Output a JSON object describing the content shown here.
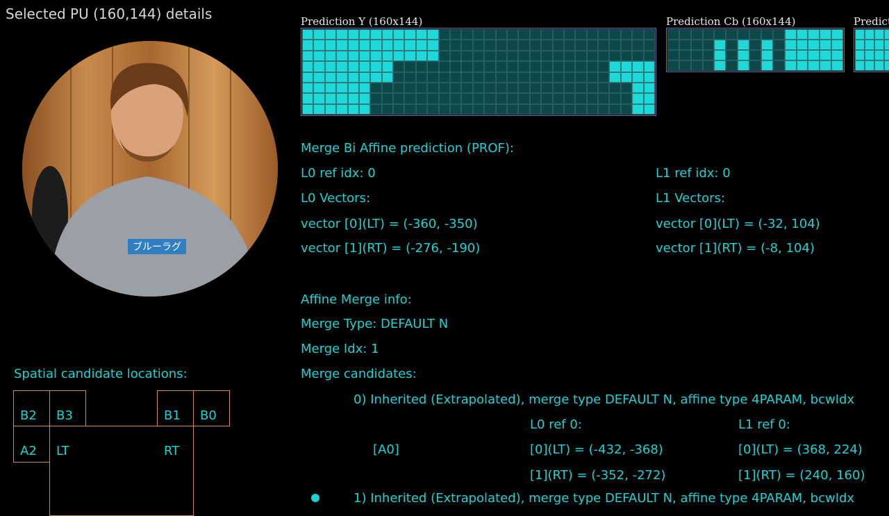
{
  "header": {
    "title": "Selected PU (160,144) details"
  },
  "avatar": {
    "shirt_text": "ブルーラグ"
  },
  "predictions": {
    "y": {
      "label": "Prediction Y (160x144)"
    },
    "cb": {
      "label": "Prediction Cb (160x144)"
    },
    "cr": {
      "label": "Predict"
    }
  },
  "merge": {
    "heading": "Merge Bi Affine prediction (PROF):",
    "l0": {
      "ref_idx": "L0 ref idx: 0",
      "vectors_label": "L0 Vectors:",
      "v0": "vector [0](LT) = (-360, -350)",
      "v1": "vector [1](RT) = (-276, -190)"
    },
    "l1": {
      "ref_idx": "L1 ref idx: 0",
      "vectors_label": "L1 Vectors:",
      "v0": "vector [0](LT) = (-32, 104)",
      "v1": "vector [1](RT) = (-8, 104)"
    }
  },
  "affine_info": {
    "heading": "Affine Merge info:",
    "merge_type": "Merge Type: DEFAULT N",
    "merge_idx": "Merge Idx: 1",
    "candidates_label": "Merge candidates:",
    "candidate0": {
      "title": "0) Inherited (Extrapolated),  merge type DEFAULT N, affine type 4PARAM, bcwIdx",
      "position": "[A0]",
      "l0_ref": "L0 ref 0:",
      "l0_v0": "[0](LT) = (-432, -368)",
      "l0_v1": "[1](RT) = (-352, -272)",
      "l1_ref": "L1 ref 0:",
      "l1_v0": "[0](LT) = (368, 224)",
      "l1_v1": "[1](RT) = (240, 160)"
    },
    "candidate1": {
      "title": "1) Inherited (Extrapolated),  merge type DEFAULT N, affine type 4PARAM, bcwIdx"
    }
  },
  "spatial": {
    "heading": "Spatial candidate locations:",
    "labels": {
      "b2": "B2",
      "b3": "B3",
      "b1": "B1",
      "b0": "B0",
      "a2": "A2",
      "lt": "LT",
      "rt": "RT"
    }
  },
  "colors": {
    "accent": "#19d3d3",
    "title": "#d6d6d6",
    "spatial_border": "#d28a4a",
    "grid_border": "#6a6ab0"
  }
}
